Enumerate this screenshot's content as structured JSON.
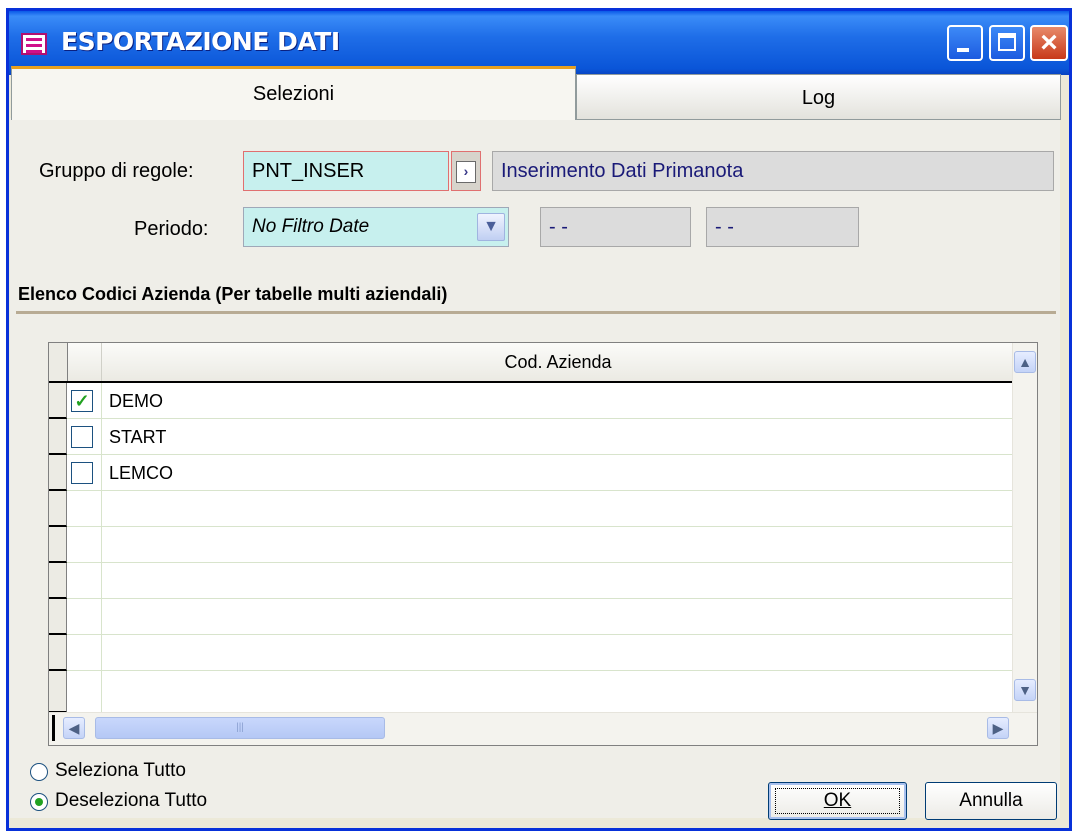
{
  "window": {
    "title": "ESPORTAZIONE DATI"
  },
  "tabs": [
    {
      "label": "Selezioni",
      "active": true
    },
    {
      "label": "Log",
      "active": false
    }
  ],
  "form": {
    "gruppo_label": "Gruppo di regole:",
    "gruppo_value": "PNT_INSER",
    "gruppo_description": "Inserimento Dati Primanota",
    "periodo_label": "Periodo:",
    "periodo_value": "No Filtro Date",
    "date_from": "- -",
    "date_to": "- -"
  },
  "section_title": "Elenco Codici Azienda (Per tabelle multi aziendali)",
  "grid": {
    "column_header": "Cod. Azienda",
    "rows": [
      {
        "code": "DEMO",
        "checked": true
      },
      {
        "code": "START",
        "checked": false
      },
      {
        "code": "LEMCO",
        "checked": false
      }
    ]
  },
  "selection": {
    "select_all": "Seleziona Tutto",
    "deselect_all": "Deseleziona Tutto",
    "selected": "deselect_all"
  },
  "buttons": {
    "ok": "OK",
    "cancel": "Annulla"
  },
  "colors": {
    "title_bar": "#0a55d8",
    "field_editable": "#c7f0ee",
    "field_readonly": "#dcdcdc",
    "check_green": "#21a121"
  }
}
